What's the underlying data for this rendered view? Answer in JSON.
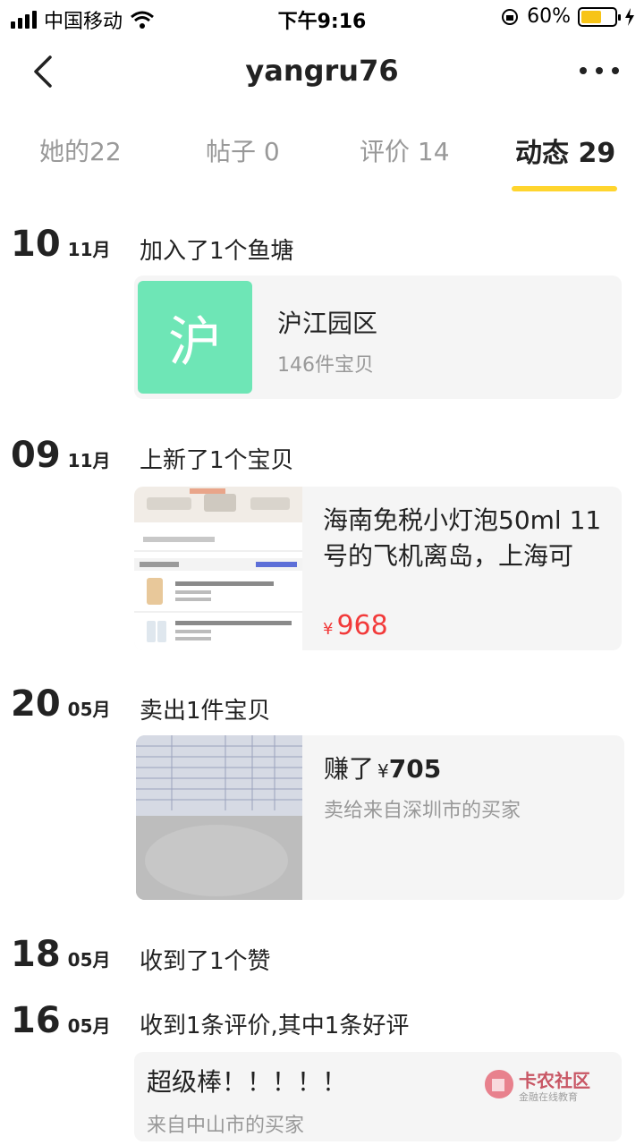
{
  "status_bar": {
    "carrier": "中国移动",
    "time": "下午9:16",
    "battery": "60%",
    "battery_level": 0.6
  },
  "nav": {
    "title": "yangru76"
  },
  "tabs": [
    {
      "label": "她的22"
    },
    {
      "label": "帖子 0"
    },
    {
      "label": "评价 14"
    },
    {
      "label": "动态 29",
      "active": true
    }
  ],
  "entries": [
    {
      "day": "10",
      "month": "11月",
      "text": "加入了1个鱼塘",
      "card": {
        "thumb_char": "沪",
        "name": "沪江园区",
        "sub": "146件宝贝"
      }
    },
    {
      "day": "09",
      "month": "11月",
      "text": "上新了1个宝贝",
      "card": {
        "title": "海南免税小灯泡50ml 11号的飞机离岛，上海可",
        "price_symbol": "¥",
        "price": "968"
      }
    },
    {
      "day": "20",
      "month": "05月",
      "text": "卖出1件宝贝",
      "card": {
        "earned_prefix": "赚了",
        "price_symbol": "¥",
        "amount": "705",
        "sub": "卖给来自深圳市的买家"
      }
    },
    {
      "day": "18",
      "month": "05月",
      "text": "收到了1个赞"
    },
    {
      "day": "16",
      "month": "05月",
      "text": "收到1条评价,其中1条好评",
      "card": {
        "review": "超级棒！！！！！",
        "sub": "来自中山市的买家"
      }
    }
  ],
  "watermark": {
    "name": "卡农社区",
    "tagline": "金融在线教育"
  },
  "colors": {
    "accent": "#ffd52e",
    "price": "#f23a3a",
    "pond_thumb": "#6ee6b6"
  }
}
